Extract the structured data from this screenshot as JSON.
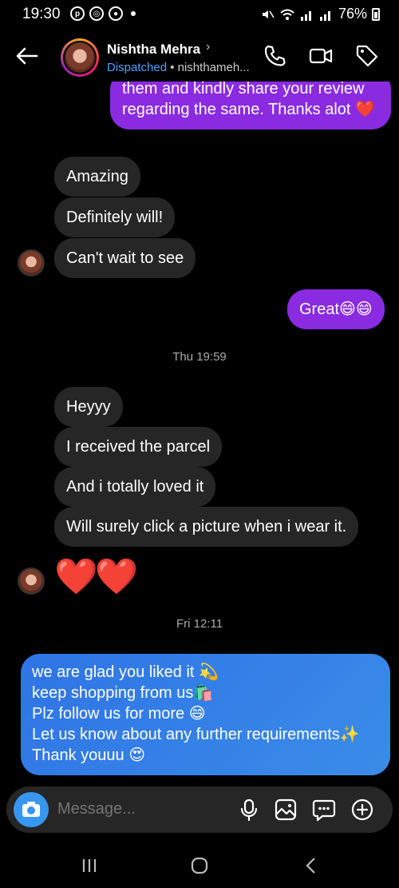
{
  "status_bar": {
    "time": "19:30",
    "battery": "76%"
  },
  "header": {
    "name": "Nishtha Mehra",
    "status": "Dispatched",
    "username": " • nishthameh..."
  },
  "messages": {
    "first_out": "them and kindly share your review regarding the same. Thanks alot ❤️",
    "in_1": "Amazing",
    "in_2": "Definitely will!",
    "in_3": "Can't wait to see",
    "out_great": "Great😄😄",
    "ts_1": "Thu 19:59",
    "in_4": "Heyyy",
    "in_5": "I received the parcel",
    "in_6": "And i totally loved it",
    "in_7": "Will surely click a picture when i wear it.",
    "hearts": "❤️❤️",
    "ts_2": "Fri 12:11",
    "final_out_lines": [
      "we are glad you liked it 💫",
      "keep shopping from us🛍️",
      "Plz follow us for more 😄",
      "Let us know about any further requirements✨",
      "Thank youuu 😍"
    ]
  },
  "composer": {
    "placeholder": "Message..."
  },
  "icons": [
    "back-arrow-icon",
    "phone-icon",
    "video-call-icon",
    "tag-icon",
    "camera-icon",
    "microphone-icon",
    "gallery-icon",
    "sticker-icon",
    "plus-icon",
    "recents-icon",
    "home-icon",
    "back-nav-icon"
  ],
  "colors": {
    "incoming": "#262626",
    "outgoing_purple": "#8a2be2",
    "outgoing_blue": "#2f74e6",
    "accent": "#3797f0"
  }
}
